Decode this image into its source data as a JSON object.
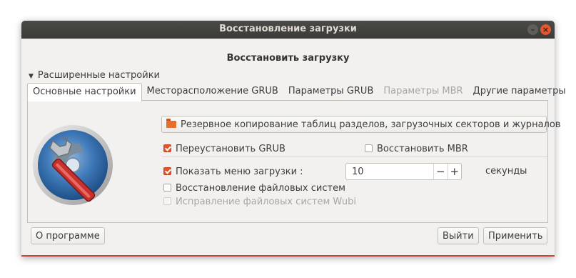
{
  "window": {
    "title": "Восстановление загрузки"
  },
  "heading": "Восстановить загрузку",
  "advanced_label": "Расширенные настройки",
  "tabs": [
    {
      "label": "Основные настройки",
      "state": "active"
    },
    {
      "label": "Месторасположение GRUB",
      "state": "normal"
    },
    {
      "label": "Параметры GRUB",
      "state": "normal"
    },
    {
      "label": "Параметры MBR",
      "state": "disabled"
    },
    {
      "label": "Другие параметры",
      "state": "normal"
    }
  ],
  "main": {
    "backup_button": "Резервное копирование таблиц разделов, загрузочных секторов и журналов",
    "reinstall_grub": {
      "label": "Переустановить GRUB",
      "checked": true
    },
    "restore_mbr": {
      "label": "Восстановить MBR",
      "checked": false
    },
    "show_boot_menu": {
      "label": "Показать меню загрузки :",
      "checked": true
    },
    "boot_menu_value": "10",
    "seconds_label": "секунды",
    "restore_fs": {
      "label": "Восстановление файловых систем",
      "checked": false
    },
    "repair_wubi": {
      "label": "Исправление файловых систем  Wubi",
      "checked": false,
      "disabled": true
    }
  },
  "footer": {
    "about_button": "О программе",
    "exit_button": "Выйти",
    "apply_button": "Применить"
  },
  "colors": {
    "accent": "#e2552c",
    "titlebar": "#3c3b37",
    "window_bg": "#f2f1f0"
  }
}
